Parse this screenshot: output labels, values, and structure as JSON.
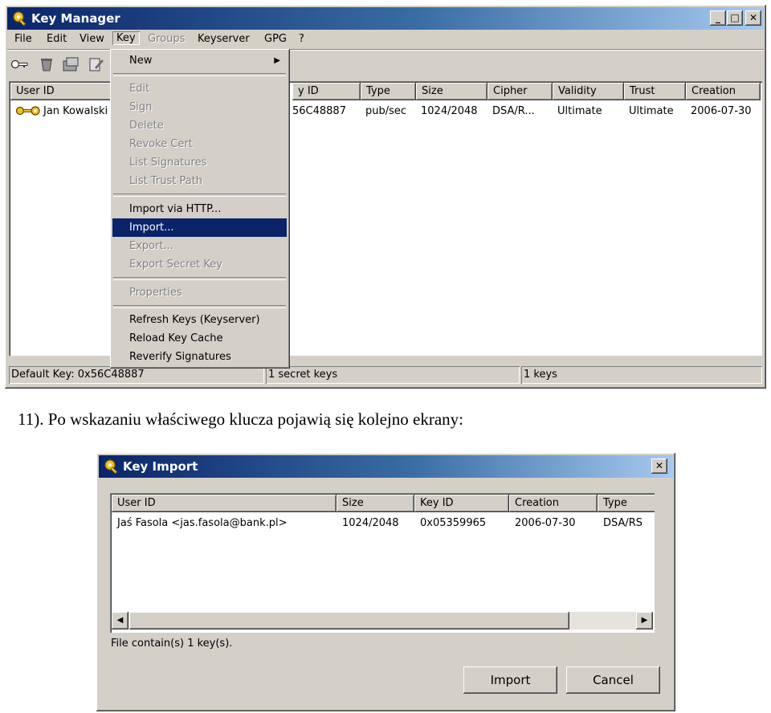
{
  "key_manager": {
    "title": "Key Manager",
    "menubar": [
      "File",
      "Edit",
      "View",
      "Key",
      "Groups",
      "Keyserver",
      "GPG",
      "?"
    ],
    "columns": [
      "User ID",
      "y ID",
      "Type",
      "Size",
      "Cipher",
      "Validity",
      "Trust",
      "Creation"
    ],
    "row": {
      "user_id": "Jan Kowalski",
      "key_id": "56C48887",
      "type": "pub/sec",
      "size": "1024/2048",
      "cipher": "DSA/R...",
      "validity": "Ultimate",
      "trust": "Ultimate",
      "creation": "2006-07-30"
    },
    "status": {
      "default_key": "Default Key: 0x56C48887",
      "secret_keys": "1 secret keys",
      "keys": "1 keys"
    },
    "key_menu": {
      "new": "New",
      "edit": "Edit",
      "sign": "Sign",
      "delete": "Delete",
      "revoke_cert": "Revoke Cert",
      "list_signatures": "List Signatures",
      "list_trust_path": "List Trust Path",
      "import_http": "Import via HTTP...",
      "import": "Import...",
      "export": "Export...",
      "export_secret": "Export Secret Key",
      "properties": "Properties",
      "refresh_keys": "Refresh Keys (Keyserver)",
      "reload_cache": "Reload Key Cache",
      "reverify": "Reverify Signatures"
    }
  },
  "caption": "11). Po wskazaniu właściwego klucza pojawią się kolejno ekrany:",
  "key_import": {
    "title": "Key Import",
    "columns": [
      "User ID",
      "Size",
      "Key ID",
      "Creation",
      "Type"
    ],
    "row": {
      "user_id": "Jaś Fasola <jas.fasola@bank.pl>",
      "size": "1024/2048",
      "key_id": "0x05359965",
      "creation": "2006-07-30",
      "type": "DSA/RS"
    },
    "file_info": "File contain(s) 1 key(s).",
    "import_button": "Import",
    "cancel_button": "Cancel"
  },
  "colors": {
    "titlebar_start": "#0a246a",
    "titlebar_end": "#a6caf0",
    "selection": "#0a246a",
    "face": "#d4d0c8"
  }
}
